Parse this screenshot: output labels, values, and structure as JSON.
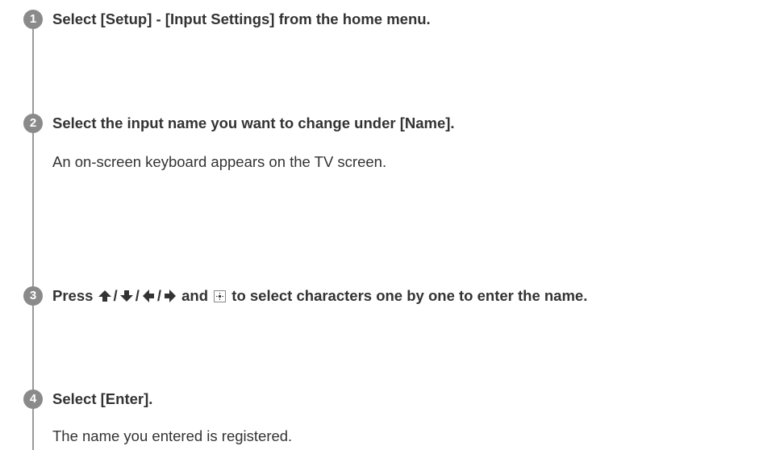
{
  "steps": [
    {
      "number": "1",
      "title": "Select [Setup] - [Input Settings] from the home menu."
    },
    {
      "number": "2",
      "title": "Select the input name you want to change under [Name].",
      "description": "An on-screen keyboard appears on the TV screen."
    },
    {
      "number": "3",
      "title_press": "Press",
      "title_and": "and",
      "title_rest": "to select characters one by one to enter the name.",
      "slash": "/"
    },
    {
      "number": "4",
      "title": "Select [Enter].",
      "description": "The name you entered is registered."
    }
  ]
}
